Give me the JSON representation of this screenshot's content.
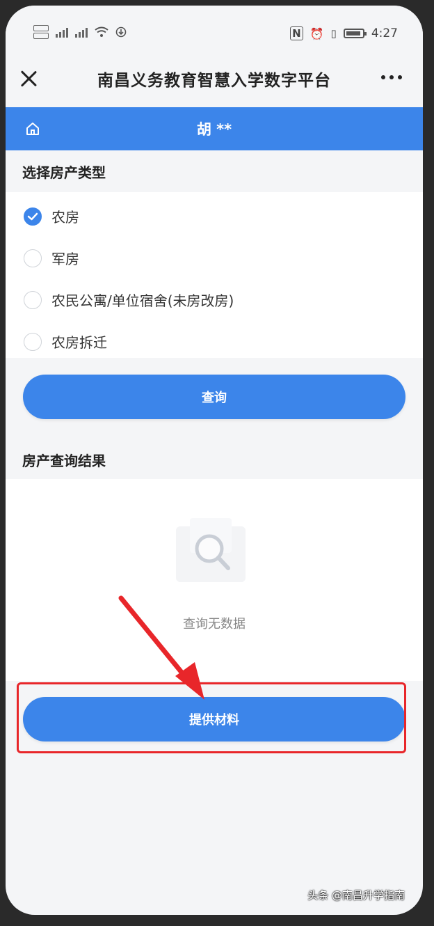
{
  "status": {
    "time": "4:27"
  },
  "header": {
    "title": "南昌义务教育智慧入学数字平台"
  },
  "user": {
    "name": "胡 **"
  },
  "property_type": {
    "title": "选择房产类型",
    "options": [
      {
        "label": "农房",
        "checked": true
      },
      {
        "label": "军房",
        "checked": false
      },
      {
        "label": "农民公寓/单位宿舍(未房改房)",
        "checked": false
      },
      {
        "label": "农房拆迁",
        "checked": false
      }
    ]
  },
  "query_button": {
    "label": "查询"
  },
  "results": {
    "title": "房产查询结果",
    "empty_text": "查询无数据"
  },
  "submit_button": {
    "label": "提供材料"
  },
  "watermark": {
    "text": "头条 @南昌升学指南"
  },
  "colors": {
    "accent": "#3c85ea",
    "highlight": "#e8262a"
  }
}
